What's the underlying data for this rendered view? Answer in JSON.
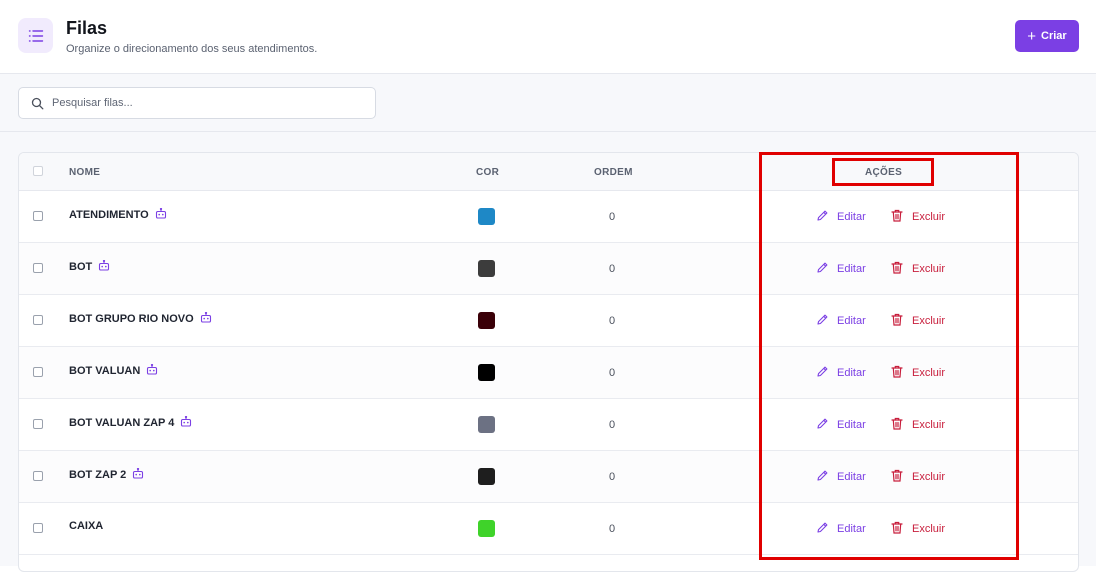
{
  "header": {
    "title": "Filas",
    "subtitle": "Organize o direcionamento dos seus atendimentos.",
    "create_label": "Criar",
    "icon": "list-icon"
  },
  "search": {
    "placeholder": "Pesquisar filas...",
    "value": ""
  },
  "table": {
    "columns": {
      "name": "NOME",
      "color": "COR",
      "order": "ORDEM",
      "actions": "AÇÕES"
    },
    "edit_label": "Editar",
    "delete_label": "Excluir",
    "rows": [
      {
        "name": "ATENDIMENTO",
        "bot_icon": true,
        "color": "#1e88c6",
        "order": "0"
      },
      {
        "name": "BOT",
        "bot_icon": true,
        "color": "#3c3c3c",
        "order": "0"
      },
      {
        "name": "BOT GRUPO RIO NOVO",
        "bot_icon": true,
        "color": "#3a0008",
        "order": "0"
      },
      {
        "name": "BOT VALUAN",
        "bot_icon": true,
        "color": "#000000",
        "order": "0"
      },
      {
        "name": "BOT VALUAN ZAP 4",
        "bot_icon": true,
        "color": "#6c7183",
        "order": "0"
      },
      {
        "name": "BOT ZAP 2",
        "bot_icon": true,
        "color": "#1e1e1e",
        "order": "0"
      },
      {
        "name": "CAIXA",
        "bot_icon": false,
        "color": "#3fd32a",
        "order": "0"
      }
    ]
  },
  "colors": {
    "accent": "#7b3fe4",
    "danger": "#c81e3c",
    "annotation": "#e00000"
  }
}
